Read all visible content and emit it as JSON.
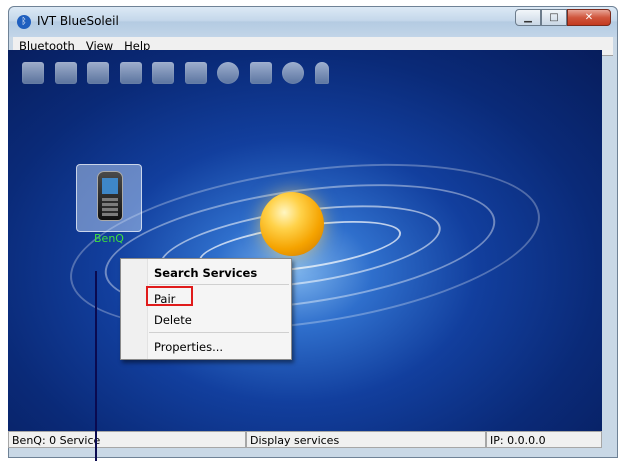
{
  "window": {
    "title": "IVT BlueSoleil"
  },
  "menu": [
    "Bluetooth",
    "View",
    "Help"
  ],
  "toolbar_icons": [
    "network-access-icon",
    "lan-access-icon",
    "fax-icon",
    "file-transfer-icon",
    "business-card-icon",
    "printer-icon",
    "mouse-icon",
    "phone-icon",
    "headset-icon",
    "earpiece-icon"
  ],
  "device": {
    "label": "BenQ",
    "icon": "mobile-phone-icon"
  },
  "context_menu": {
    "items": [
      "Search Services",
      "Pair",
      "Delete",
      "Properties..."
    ]
  },
  "highlight_color": "#e01b1b",
  "status": {
    "left": "BenQ: 0 Service",
    "middle": "Display services",
    "right": "IP: 0.0.0.0"
  }
}
